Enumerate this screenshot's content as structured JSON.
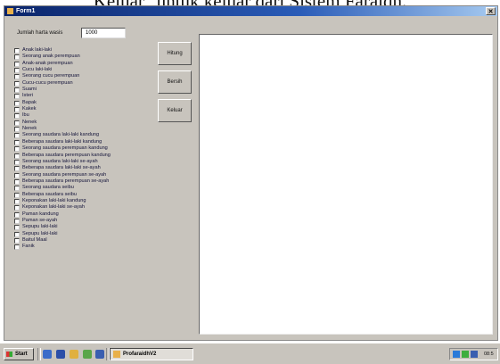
{
  "caption": "Keluar\" untuk keluar dari Sistem Faraidh.",
  "window": {
    "title": "Form1",
    "close_glyph": "✕"
  },
  "form": {
    "jumlah_label": "Jumlah harta wasis",
    "jumlah_value": "1000",
    "checkboxes": [
      "Anak laki-laki",
      "Seorang anak perempuan",
      "Anak-anak perempuan",
      "Cucu laki-laki",
      "Seorang cucu perempuan",
      "Cucu-cucu perempuan",
      "Suami",
      "Isteri",
      "Bapak",
      "Kakek",
      "Ibu",
      "Nenek",
      "Nenek",
      "Seorang saudara laki-laki kandung",
      "Beberapa saudara laki-laki kandung",
      "Seorang saudara perempuan kandung",
      "Beberapa saudara perempuan kandung",
      "Seorang saudara laki-laki se-ayah",
      "Beberapa saudara laki-laki se-ayah",
      "Seorang saudara perempuan se-ayah",
      "Beberapa saudara perempuan se-ayah",
      "Seorang saudara seibu",
      "Beberapa saudara seibu",
      "Keponakan laki-laki kandung",
      "Keponakan laki-laki se-ayah",
      "Paman kandung",
      "Paman se-ayah",
      "Sepupu laki-laki",
      "Sepupu laki-laki",
      "Baitul Maal",
      "Fanik"
    ],
    "buttons": {
      "hitung": "Hitung",
      "bersih": "Bersih",
      "keluar": "Keluar"
    }
  },
  "taskbar": {
    "start_label": "Start",
    "task_label": "ProfaraidhV2",
    "clock": "08:5"
  },
  "colors": {
    "title_bar": "#0a246a",
    "window_bg": "#c8c4bd",
    "output_bg": "#ffffff"
  },
  "icons": [
    "start-logo-icon",
    "desktop-icon",
    "word-icon",
    "explorer-icon",
    "paint-icon",
    "app-icon",
    "network-icon",
    "volume-icon"
  ]
}
